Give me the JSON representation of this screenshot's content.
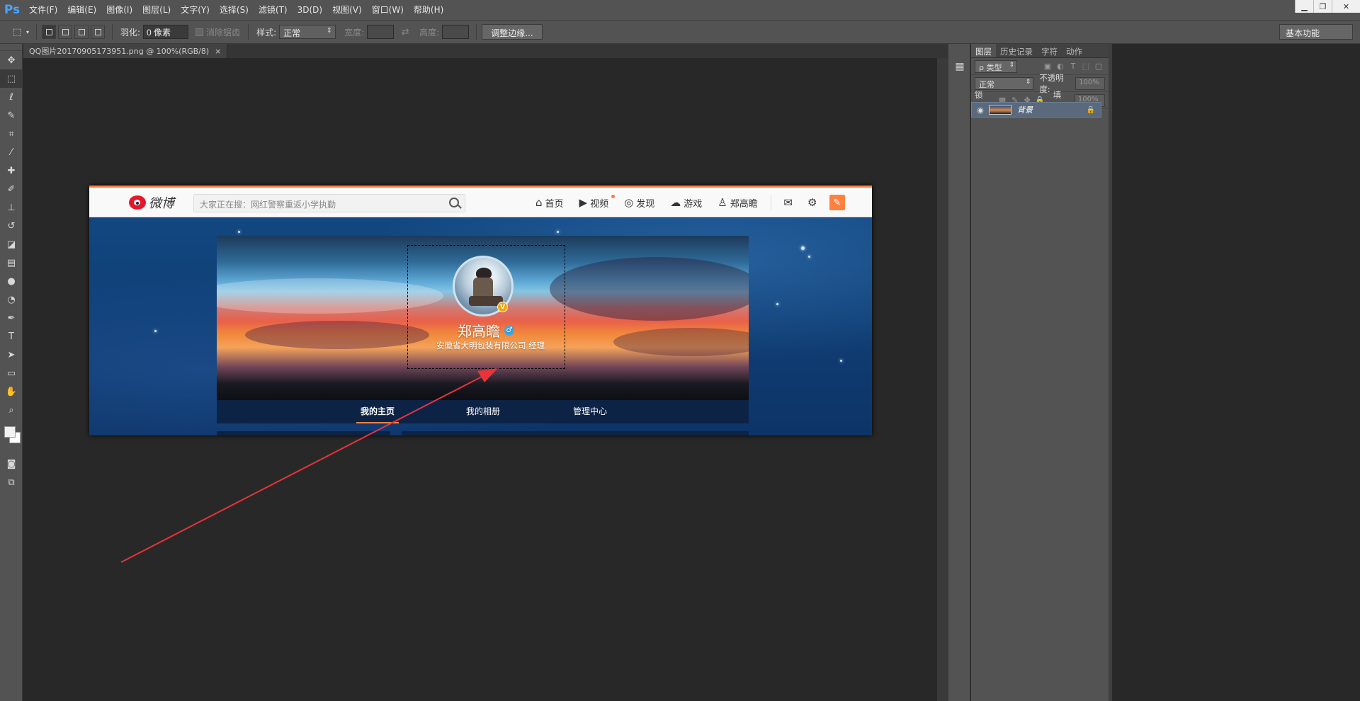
{
  "app": {
    "logo": "Ps",
    "menu": [
      "文件(F)",
      "编辑(E)",
      "图像(I)",
      "图层(L)",
      "文字(Y)",
      "选择(S)",
      "滤镜(T)",
      "3D(D)",
      "视图(V)",
      "窗口(W)",
      "帮助(H)"
    ]
  },
  "options": {
    "feather_label": "羽化:",
    "feather_value": "0 像素",
    "antialias_label": "消除锯齿",
    "style_label": "样式:",
    "style_value": "正常",
    "width_label": "宽度:",
    "height_label": "高度:",
    "refine_button": "调整边缘...",
    "workspace": "基本功能"
  },
  "document": {
    "tab_title": "QQ图片20170905173951.png @ 100%(RGB/8)",
    "tab_close": "×"
  },
  "weibo": {
    "logo_text": "微博",
    "search_placeholder": "大家正在搜：网红警察重返小学执勤",
    "nav": [
      "首页",
      "视频",
      "发现",
      "游戏",
      "郑高瞻"
    ],
    "user_name": "郑高瞻",
    "verified_badge": "V",
    "gender_symbol": "♂",
    "user_desc": "安徽省大明包装有限公司 经理",
    "tabs": [
      "我的主页",
      "我的相册",
      "管理中心"
    ]
  },
  "panels": {
    "tabs": [
      "图层",
      "历史记录",
      "字符",
      "动作"
    ],
    "filter_kind": "ρ 类型",
    "blend_mode": "正常",
    "opacity_label": "不透明度:",
    "opacity_value": "100%",
    "lock_label": "锁定:",
    "fill_label": "填充:",
    "fill_value": "100%",
    "layer_name": "背景"
  },
  "colors": {
    "ps_panel": "#535353",
    "ps_canvas_bg": "#282828",
    "weibo_orange": "#ff8140",
    "annotation_arrow": "#e8333a"
  }
}
